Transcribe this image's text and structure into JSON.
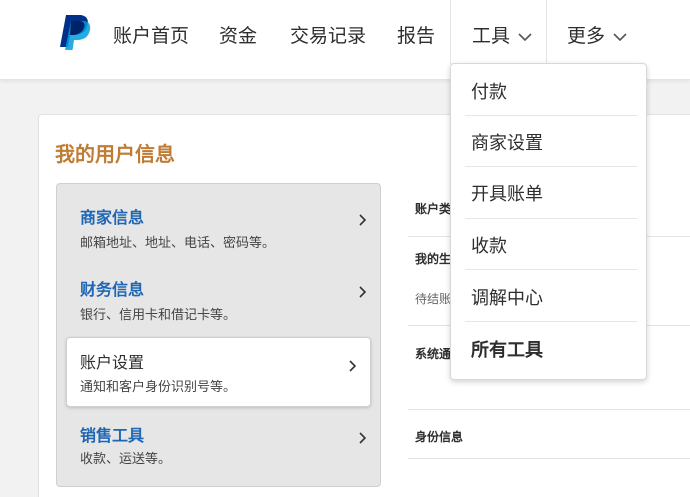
{
  "nav": {
    "items": [
      {
        "label": "账户首页"
      },
      {
        "label": "资金"
      },
      {
        "label": "交易记录"
      },
      {
        "label": "报告"
      },
      {
        "label": "工具"
      },
      {
        "label": "更多"
      }
    ]
  },
  "section": {
    "title": "我的用户信息"
  },
  "side": {
    "items": [
      {
        "title": "商家信息",
        "desc": "邮箱地址、地址、电话、密码等。"
      },
      {
        "title": "财务信息",
        "desc": "银行、信用卡和借记卡等。"
      },
      {
        "title": "账户设置",
        "desc": "通知和客户身份识别号等。"
      },
      {
        "title": "销售工具",
        "desc": "收款、运送等。"
      }
    ]
  },
  "right": {
    "rows": [
      {
        "label": "账户类"
      },
      {
        "label": "我的生",
        "sub": "待结账"
      },
      {
        "label": "系统通"
      },
      {
        "label": "身份信息"
      }
    ]
  },
  "dropdown": {
    "items": [
      {
        "label": "付款"
      },
      {
        "label": "商家设置"
      },
      {
        "label": "开具账单"
      },
      {
        "label": "收款"
      },
      {
        "label": "调解中心"
      },
      {
        "label": "所有工具"
      }
    ]
  },
  "colors": {
    "brand": "#003087",
    "brand_light": "#009cde",
    "section_title": "#c07c35",
    "link": "#1f67b4"
  },
  "icons": {
    "logo": "paypal-logo",
    "chevron": "chevron-down-icon",
    "arrow": "chevron-right-icon"
  }
}
